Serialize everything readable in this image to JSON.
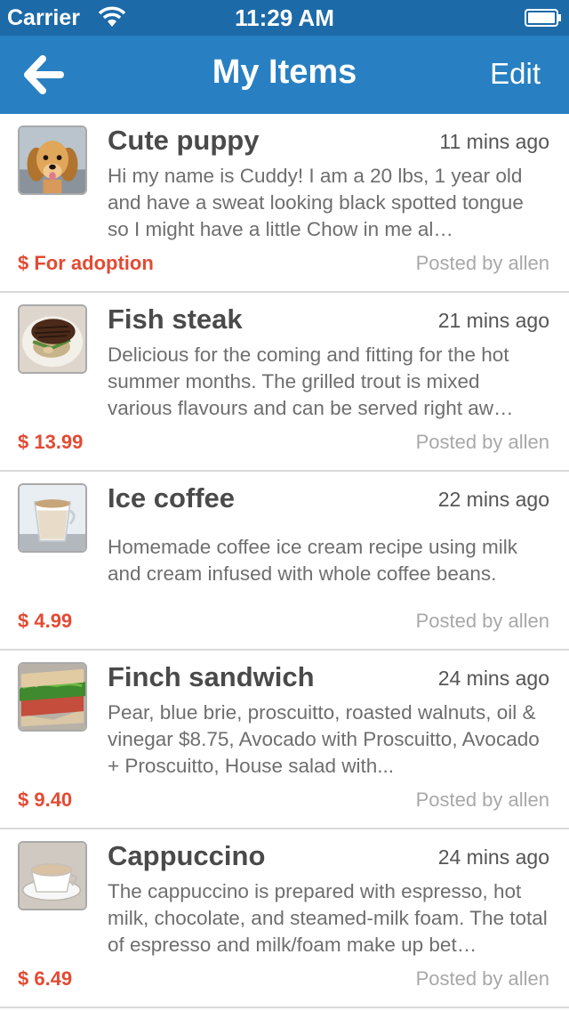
{
  "status_bar": {
    "carrier": "Carrier",
    "time": "11:29 AM"
  },
  "nav": {
    "title": "My Items",
    "edit_label": "Edit",
    "back_icon": "arrow-left-icon"
  },
  "colors": {
    "status_bar_bg": "#1d6aa8",
    "nav_bg": "#2880c2",
    "price": "#e34a33",
    "divider": "#d9d9d9"
  },
  "items": [
    {
      "title": "Cute puppy",
      "time": "11 mins ago",
      "description": "Hi my name is Cuddy! I am a 20 lbs,  1 year old and have a sweat looking black spotted tongue so I might have a little Chow in me al…",
      "price": "$ For adoption",
      "posted_by": "Posted by allen",
      "thumbnail": "puppy"
    },
    {
      "title": "Fish steak",
      "time": "21 mins ago",
      "description": "Delicious for the coming and fitting for the hot summer months. The grilled trout is mixed various flavours and can be served right aw…",
      "price": "$ 13.99",
      "posted_by": "Posted by allen",
      "thumbnail": "fish-steak"
    },
    {
      "title": "Ice coffee",
      "time": "22 mins ago",
      "description": "Homemade coffee ice cream recipe using milk and cream infused with whole coffee beans.",
      "price": "$ 4.99",
      "posted_by": "Posted by allen",
      "thumbnail": "ice-coffee"
    },
    {
      "title": "Finch sandwich",
      "time": "24 mins ago",
      "description": "Pear, blue brie, proscuitto, roasted walnuts, oil & vinegar $8.75, Avocado with Proscuitto, Avocado + Proscuitto, House salad with...",
      "price": "$ 9.40",
      "posted_by": "Posted by allen",
      "thumbnail": "sandwich"
    },
    {
      "title": "Cappuccino",
      "time": "24 mins ago",
      "description": "The cappuccino is prepared with espresso, hot milk, chocolate, and steamed-milk foam. The total of espresso and milk/foam make up bet…",
      "price": "$ 6.49",
      "posted_by": "Posted by allen",
      "thumbnail": "cappuccino"
    }
  ]
}
